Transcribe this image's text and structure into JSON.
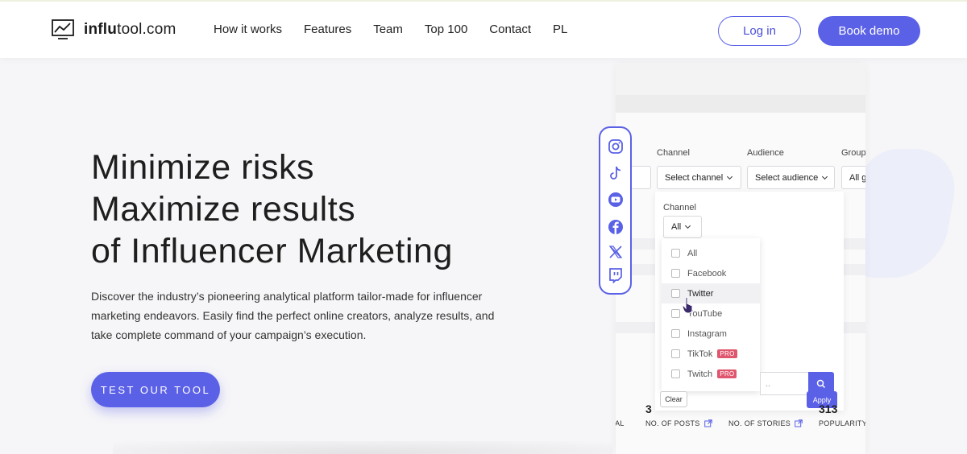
{
  "header": {
    "logo_text_bold": "influ",
    "logo_text_rest": "tool.com",
    "nav": [
      "How it works",
      "Features",
      "Team",
      "Top 100",
      "Contact",
      "PL"
    ],
    "login_label": "Log in",
    "demo_label": "Book demo"
  },
  "hero": {
    "title_lines": [
      "Minimize risks",
      "Maximize results",
      "of Influencer Marketing"
    ],
    "description": "Discover the industry’s pioneering analytical platform tailor-made for influencer marketing endeavors. Easily find the perfect online creators, analyze results, and take complete command of your campaign’s execution.",
    "cta_label": "TEST OUR TOOL"
  },
  "mock": {
    "filters": {
      "channel_label": "Channel",
      "audience_label": "Audience",
      "group_label": "Group",
      "channel_select": "Select channel",
      "audience_select": "Select audience",
      "group_select": "All g"
    },
    "dropdown": {
      "label": "Channel",
      "selected": "All",
      "options": [
        {
          "label": "All",
          "pro": false
        },
        {
          "label": "Facebook",
          "pro": false
        },
        {
          "label": "Twitter",
          "pro": false
        },
        {
          "label": "YouTube",
          "pro": false
        },
        {
          "label": "Instagram",
          "pro": false
        },
        {
          "label": "TikTok",
          "pro": true
        },
        {
          "label": "Twitch",
          "pro": true
        }
      ],
      "pro_badge": "PRO",
      "clear_label": "Clear",
      "apply_label": "Apply"
    },
    "stats": [
      {
        "num": "3",
        "label": "NO. OF POSTS"
      },
      {
        "num": "",
        "label": "NO. OF STORIES"
      },
      {
        "num": "313",
        "label": "POPULARITY"
      }
    ],
    "total_label_fragment": "TAL",
    "social_icons": [
      "instagram-icon",
      "tiktok-icon",
      "youtube-icon",
      "facebook-icon",
      "x-icon",
      "twitch-icon"
    ]
  },
  "colors": {
    "accent": "#5b61e6",
    "pro": "#e0566e"
  }
}
